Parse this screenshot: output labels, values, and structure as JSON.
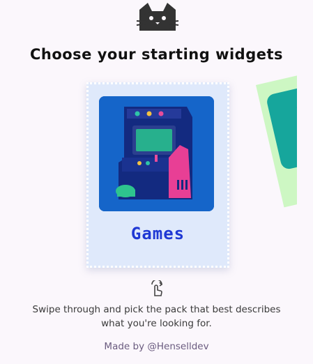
{
  "header": {
    "icon": "cat-icon",
    "title": "Choose your starting widgets"
  },
  "carousel": {
    "current": {
      "label": "Games",
      "icon": "arcade-machine-icon",
      "background": "#dfe9fb",
      "art_background": "#1565c9"
    },
    "next": {
      "icon": "mountain-icon",
      "background": "#cdf7c3",
      "art_background": "#16a69c"
    }
  },
  "hint": {
    "icon": "swipe-gesture-icon",
    "text": "Swipe through and pick the pack that best describes what you're looking for."
  },
  "footer": {
    "credit": "Made by @Henselldev"
  },
  "colors": {
    "page_background": "#fbf7fc",
    "label_color": "#1f38d4"
  }
}
